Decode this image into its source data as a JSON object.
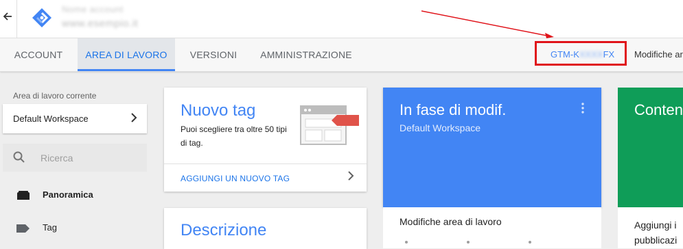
{
  "topbar": {
    "back_icon": "arrow-back-icon",
    "logo_icon": "gtm-logo-icon",
    "account_name": "Nome account",
    "container_name": "www.esempio.it"
  },
  "nav": {
    "tabs": [
      {
        "label": "ACCOUNT",
        "active": false
      },
      {
        "label": "AREA DI LAVORO",
        "active": true
      },
      {
        "label": "VERSIONI",
        "active": false
      },
      {
        "label": "AMMINISTRAZIONE",
        "active": false
      }
    ],
    "container_id_prefix": "GTM-K",
    "container_id_blurred": "XXXX",
    "container_id_suffix": "FX",
    "changes_label": "Modifiche area"
  },
  "sidebar": {
    "current_ws_label": "Area di lavoro corrente",
    "workspace_name": "Default Workspace",
    "search_placeholder": "Ricerca",
    "items": [
      {
        "label": "Panoramica",
        "icon": "folder-icon"
      },
      {
        "label": "Tag",
        "icon": "tag-icon"
      }
    ]
  },
  "cards": {
    "new_tag": {
      "title": "Nuovo tag",
      "description": "Puoi scegliere tra oltre 50 tipi di tag.",
      "link": "AGGIUNGI UN NUOVO TAG"
    },
    "description": {
      "title": "Descrizione"
    },
    "editing": {
      "title": "In fase di modif.",
      "subtitle": "Default Workspace",
      "footer_title": "Modifiche area di lavoro"
    },
    "container": {
      "title": "Conten",
      "line1": "Aggiungi i",
      "line2": "pubblicazi"
    }
  },
  "colors": {
    "accent_blue": "#4285f4",
    "green": "#0f9d58",
    "annotation_red": "#e0131a",
    "tag_badge_red": "#e0534a"
  }
}
